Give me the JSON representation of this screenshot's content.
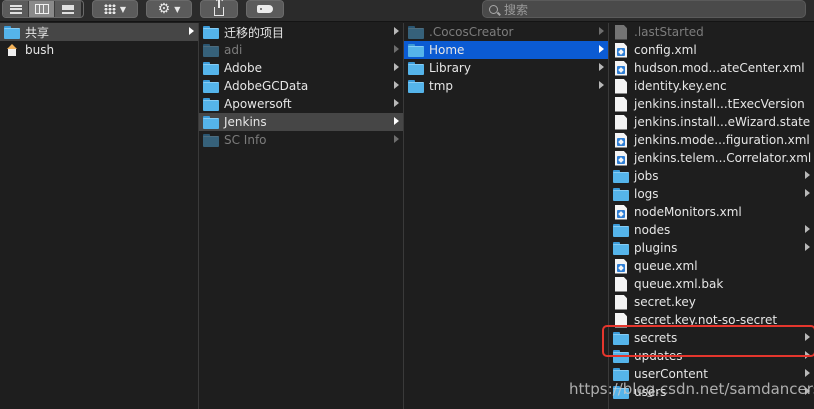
{
  "toolbar": {
    "view_buttons": [
      {
        "name": "list-view",
        "active": false
      },
      {
        "name": "column-view",
        "active": true
      },
      {
        "name": "gallery-view",
        "active": false
      }
    ],
    "group_button": "grid-icon",
    "action_button": "gear-icon",
    "share_button": "share-icon",
    "tag_button": "tag-icon",
    "search": {
      "placeholder": "搜索"
    }
  },
  "columns": [
    {
      "items": [
        {
          "label": "共享",
          "icon": "folder",
          "arrow": true,
          "state": "selected-gray"
        },
        {
          "label": "bush",
          "icon": "home",
          "arrow": false,
          "state": "normal"
        }
      ]
    },
    {
      "items": [
        {
          "label": "迁移的项目",
          "icon": "folder",
          "arrow": true,
          "state": "normal"
        },
        {
          "label": "adi",
          "icon": "folder",
          "arrow": true,
          "state": "dim"
        },
        {
          "label": "Adobe",
          "icon": "folder",
          "arrow": true,
          "state": "normal"
        },
        {
          "label": "AdobeGCData",
          "icon": "folder",
          "arrow": true,
          "state": "normal"
        },
        {
          "label": "Apowersoft",
          "icon": "folder",
          "arrow": true,
          "state": "normal"
        },
        {
          "label": "Jenkins",
          "icon": "folder",
          "arrow": true,
          "state": "selected-gray"
        },
        {
          "label": "SC Info",
          "icon": "folder",
          "arrow": true,
          "state": "dim"
        }
      ]
    },
    {
      "items": [
        {
          "label": ".CocosCreator",
          "icon": "folder",
          "arrow": true,
          "state": "dim"
        },
        {
          "label": "Home",
          "icon": "folder",
          "arrow": true,
          "state": "selected-blue"
        },
        {
          "label": "Library",
          "icon": "folder",
          "arrow": true,
          "state": "normal"
        },
        {
          "label": "tmp",
          "icon": "folder",
          "arrow": true,
          "state": "normal"
        }
      ]
    },
    {
      "items": [
        {
          "label": ".lastStarted",
          "icon": "file",
          "arrow": false,
          "state": "dim"
        },
        {
          "label": "config.xml",
          "icon": "xml",
          "arrow": false,
          "state": "normal"
        },
        {
          "label": "hudson.mod...ateCenter.xml",
          "icon": "xml",
          "arrow": false,
          "state": "normal"
        },
        {
          "label": "identity.key.enc",
          "icon": "file",
          "arrow": false,
          "state": "normal"
        },
        {
          "label": "jenkins.install...tExecVersion",
          "icon": "file",
          "arrow": false,
          "state": "normal"
        },
        {
          "label": "jenkins.install...eWizard.state",
          "icon": "file",
          "arrow": false,
          "state": "normal"
        },
        {
          "label": "jenkins.mode...figuration.xml",
          "icon": "xml",
          "arrow": false,
          "state": "normal"
        },
        {
          "label": "jenkins.telem...Correlator.xml",
          "icon": "xml",
          "arrow": false,
          "state": "normal"
        },
        {
          "label": "jobs",
          "icon": "folder",
          "arrow": true,
          "state": "normal"
        },
        {
          "label": "logs",
          "icon": "folder",
          "arrow": true,
          "state": "normal"
        },
        {
          "label": "nodeMonitors.xml",
          "icon": "xml",
          "arrow": false,
          "state": "normal"
        },
        {
          "label": "nodes",
          "icon": "folder",
          "arrow": true,
          "state": "normal"
        },
        {
          "label": "plugins",
          "icon": "folder",
          "arrow": true,
          "state": "normal"
        },
        {
          "label": "queue.xml",
          "icon": "xml",
          "arrow": false,
          "state": "normal"
        },
        {
          "label": "queue.xml.bak",
          "icon": "file",
          "arrow": false,
          "state": "normal"
        },
        {
          "label": "secret.key",
          "icon": "file",
          "arrow": false,
          "state": "normal"
        },
        {
          "label": "secret.key.not-so-secret",
          "icon": "file",
          "arrow": false,
          "state": "normal"
        },
        {
          "label": "secrets",
          "icon": "folder",
          "arrow": true,
          "state": "normal"
        },
        {
          "label": "updates",
          "icon": "folder",
          "arrow": true,
          "state": "normal"
        },
        {
          "label": "userContent",
          "icon": "folder",
          "arrow": true,
          "state": "normal"
        },
        {
          "label": "users",
          "icon": "folder",
          "arrow": true,
          "state": "normal"
        }
      ]
    }
  ],
  "annotation": {
    "color": "#e5362d",
    "target": "secrets"
  },
  "watermark": "https://blog.csdn.net/samdancers",
  "colors": {
    "selection_blue": "#0b5bd3",
    "selection_gray": "#464646",
    "folder": "#55b4ea"
  }
}
